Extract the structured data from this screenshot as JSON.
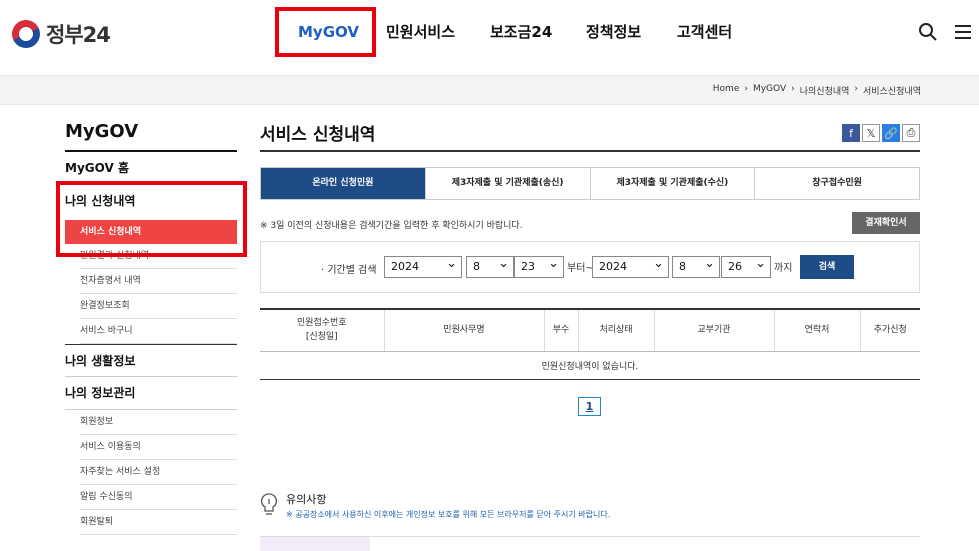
{
  "header": {
    "logo_text": "정부24",
    "nav": [
      "MyGOV",
      "민원서비스",
      "보조금24",
      "정책정보",
      "고객센터"
    ]
  },
  "breadcrumb": [
    "Home",
    "›",
    "MyGOV",
    "›",
    "나의신청내역",
    "›",
    "서비스신청내역"
  ],
  "sidebar": {
    "title": "MyGOV",
    "home": "MyGOV 홈",
    "menus": [
      {
        "label": "나의 신청내역",
        "items": [
          "서비스 신청내역",
          "민원결과 신청내역",
          "전자증명서 내역",
          "완결정보조회",
          "서비스 바구니"
        ]
      },
      {
        "label": "나의 생활정보",
        "items": []
      },
      {
        "label": "나의 정보관리",
        "items": [
          "회원정보",
          "서비스 이용동의",
          "자주찾는 서비스 설정",
          "알림 수신동의",
          "회원탈퇴"
        ]
      }
    ]
  },
  "main": {
    "title": "서비스 신청내역",
    "tabs": [
      "온라인 신청민원",
      "제3자제출 및 기관제출(송신)",
      "제3자제출 및 기관제출(수신)",
      "창구접수민원"
    ],
    "notice": "※ 3일 이전의 신청내용은 검색기간을 입력한 후 확인하시기 바랍니다.",
    "cert_button": "결재확인서",
    "search": {
      "label": "기간별 검색",
      "from_year": "2024",
      "from_month": "8",
      "from_day": "23",
      "from_suffix": "부터~",
      "to_year": "2024",
      "to_month": "8",
      "to_day": "26",
      "to_suffix": "까지",
      "button": "검색"
    },
    "table": {
      "headers": [
        "민원접수번호",
        "[신청일]",
        "민원사무명",
        "부수",
        "처리상태",
        "교부기관",
        "연락처",
        "추가신청"
      ],
      "empty": "민원신청내역이 없습니다."
    },
    "page": "1",
    "caution": {
      "title": "유의사항",
      "text": "※ 공공장소에서 사용하신 이후에는 개인정보 보호를 위해 모든 브라우저를 닫아 주시기 바랍니다."
    }
  },
  "colors": {
    "accent": "#1e4c86",
    "highlight": "#e8000e",
    "active_menu": "#ef4444"
  }
}
